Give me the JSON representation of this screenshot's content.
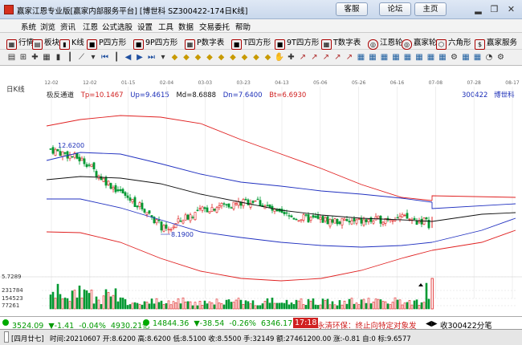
{
  "titlebar": {
    "title": "赢家江恩专业版[赢家内部服务平台] [博世科  SZ300422-174日K线]",
    "buttons": [
      "客服",
      "论坛",
      "主页"
    ],
    "window_controls": [
      "minimize-icon",
      "restore-icon",
      "close-icon"
    ]
  },
  "menubar": {
    "items": [
      "系统",
      "浏览",
      "资讯",
      "江恩",
      "公式选股",
      "设置",
      "工具",
      "数据",
      "交易委托",
      "帮助"
    ]
  },
  "toolbar1": {
    "items": [
      {
        "label": "行情",
        "icon": "grid-icon"
      },
      {
        "label": "板块",
        "icon": "blocks-icon"
      },
      {
        "label": "K线",
        "icon": "candle-icon"
      },
      {
        "label": "P四方形",
        "icon": "square-icon"
      },
      {
        "label": "9P四方形",
        "icon": "square-icon"
      },
      {
        "label": "P数字表",
        "icon": "table-icon"
      },
      {
        "label": "T四方形",
        "icon": "square-icon"
      },
      {
        "label": "9T四方形",
        "icon": "square-icon"
      },
      {
        "label": "T数字表",
        "icon": "table-icon"
      },
      {
        "label": "江恩轮",
        "icon": "wheel-icon"
      },
      {
        "label": "赢家轮",
        "icon": "wheel-icon"
      },
      {
        "label": "六角形",
        "icon": "hexagon-icon"
      },
      {
        "label": "赢家服务",
        "icon": "service-icon"
      }
    ]
  },
  "toolbar2": {
    "icons": [
      "chart-type-icon",
      "zoom-icon",
      "cross-icon",
      "grid-icon",
      "candle-icon",
      "bar-icon",
      "line-icon",
      "down-icon",
      "skip-start-icon",
      "bar-icon",
      "step-back-icon",
      "step-forward-icon",
      "skip-end-icon",
      "chevron-down-icon",
      "diamond-icon",
      "diamond-icon",
      "diamond-icon",
      "diamond-icon",
      "diamond-icon",
      "diamond-icon",
      "diamond-icon",
      "diamond-icon",
      "diamond-icon",
      "hand-icon",
      "cross-icon",
      "draw-icon",
      "draw-icon",
      "draw-icon",
      "draw-icon",
      "draw-icon",
      "table-icon",
      "table-icon",
      "table-icon",
      "table-icon",
      "table-icon",
      "table-icon",
      "table-icon",
      "table-icon",
      "gear-icon",
      "table-icon",
      "table-icon",
      "gauge-icon",
      "gear-icon"
    ]
  },
  "chart": {
    "period_label": "日K线",
    "indicator_name": "极反通道",
    "tp_label": "Tp=10.1467",
    "up_label": "Up=9.4615",
    "md_label": "Md=8.6888",
    "dn_label": "Dn=7.6400",
    "bt_label": "Bt=6.6930",
    "code_label": "300422",
    "name_label": "博世科",
    "annot_high": "12.6200",
    "annot_low": "8.1900"
  },
  "chart_data": {
    "type": "line",
    "x_labels": [
      "12-02",
      "12-02",
      "01-15",
      "02-04",
      "03-03",
      "03-23",
      "04-13",
      "05-06",
      "05-26",
      "06-16",
      "07-08",
      "07-28",
      "08-17"
    ],
    "price_ylim": [
      5.7,
      14.5
    ],
    "close_price_end": 8.62,
    "annotations": [
      {
        "label": "12.6200",
        "value": 12.62
      },
      {
        "label": "8.1900",
        "value": 8.19
      }
    ],
    "series_levels": {
      "Tp": 10.1467,
      "Up": 9.4615,
      "Md": 8.6888,
      "Dn": 7.64,
      "Bt": 6.693
    },
    "volume_tick_labels": [
      "5.7289",
      "231784",
      "154523",
      "77261"
    ]
  },
  "status1": {
    "sh_index": "3524.09",
    "sh_change": "▼-1.41",
    "sh_pct": "-0.04%",
    "sh_amount": "4930.21亿",
    "sz_index": "14844.36",
    "sz_change": "▼-38.54",
    "sz_pct": "-0.26%",
    "sz_amount": "6346.17",
    "time_badge": "17:18",
    "news": "永清环保：终止向特定对象发",
    "right_text": "收300422分笔"
  },
  "status2": {
    "day_tag": "[四月廿七]",
    "text": "时间:20210607 开:8.6200 高:8.6200 低:8.5100 收:8.5500 手:32149 额:27461200.00 涨:-0.81 自:0 标:9.6577"
  },
  "colors": {
    "red_line": "#e02020",
    "blue_line": "#2030c0",
    "black_line": "#101010",
    "up_candle": "#e02020",
    "down_candle": "#009933"
  }
}
